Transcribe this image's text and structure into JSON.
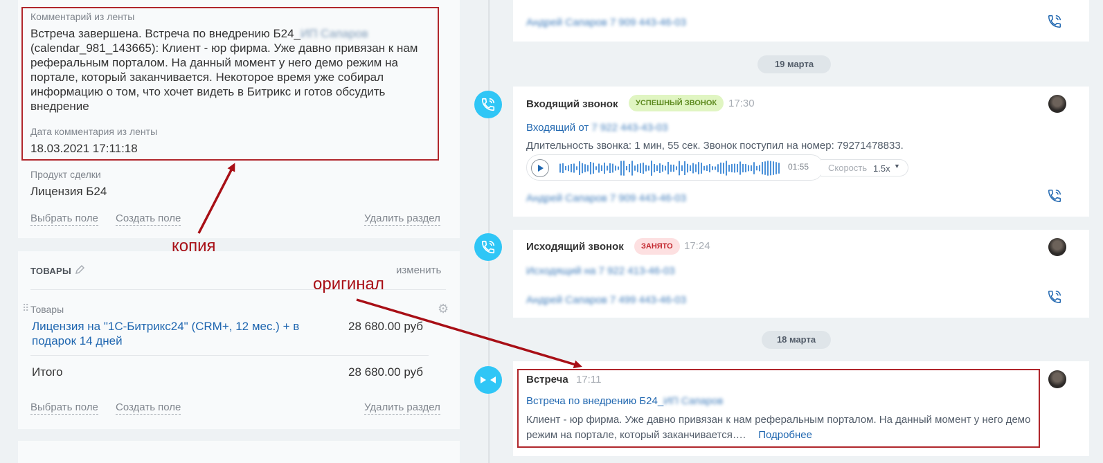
{
  "left": {
    "feed_comment_label": "Комментарий из ленты",
    "feed_comment_text": "Встреча завершена. Встреча по внедрению Б24_",
    "feed_comment_blur": "ИП Сапаров",
    "feed_comment_text2": "(calendar_981_143665): Клиент - юр фирма. Уже давно привязан к нам реферальным порталом. На данный момент у него демо режим на портале, который заканчивается. Некоторое время уже собирал информацию о том, что хочет видеть в Битрикс и готов обсудить внедрение",
    "feed_date_label": "Дата комментария из ленты",
    "feed_date_value": "18.03.2021 17:11:18",
    "product_label": "Продукт сделки",
    "product_value": "Лицензия Б24",
    "select_field": "Выбрать поле",
    "create_field": "Создать поле",
    "delete_section": "Удалить раздел",
    "goods_title": "ТОВАРЫ",
    "goods_change": "изменить",
    "goods_label": "Товары",
    "goods_item": "Лицензия на \"1С-Битрикс24\" (CRM+, 12 мес.) + в подарок 14 дней",
    "goods_item_price": "28 680.00 руб",
    "total_label": "Итого",
    "total_value": "28 680.00 руб"
  },
  "annotations": {
    "copy": "копия",
    "original": "оригинал"
  },
  "timeline": {
    "top_blur": "Андрей Сапаров 7 909 443-46-03",
    "date1": "19 марта",
    "call_in": {
      "title": "Входящий звонок",
      "badge": "УСПЕШНЫЙ ЗВОНОК",
      "time": "17:30",
      "from_label": "Входящий от",
      "from_blur": "7 922 443-43-03",
      "duration": "Длительность звонка: 1 мин, 55 сек. Звонок поступил на номер: 79271478833.",
      "audio_time": "01:55",
      "speed_label": "Скорость",
      "speed_value": "1.5x",
      "contact_blur": "Андрей Сапаров 7 909 443-46-03"
    },
    "call_out": {
      "title": "Исходящий звонок",
      "badge": "ЗАНЯТО",
      "time": "17:24",
      "line_blur": "Исходящий на 7 922 413-46-03",
      "contact_blur": "Андрей Сапаров 7 499 443-46-03"
    },
    "date2": "18 марта",
    "meeting": {
      "title": "Встреча",
      "time": "17:11",
      "link": "Встреча по внедрению Б24_",
      "link_blur": "ИП Сапаров",
      "text": "Клиент - юр фирма. Уже давно привязан к нам реферальным порталом. На данный момент у него демо режим на портале, который заканчивается….",
      "more": "Подробнее"
    }
  },
  "colors": {
    "accent": "#2fc6f6",
    "link": "#2067b0",
    "annotation": "#a80f16",
    "success_badge_bg": "#e0f5c2",
    "busy_badge_bg": "#fde0e1"
  }
}
